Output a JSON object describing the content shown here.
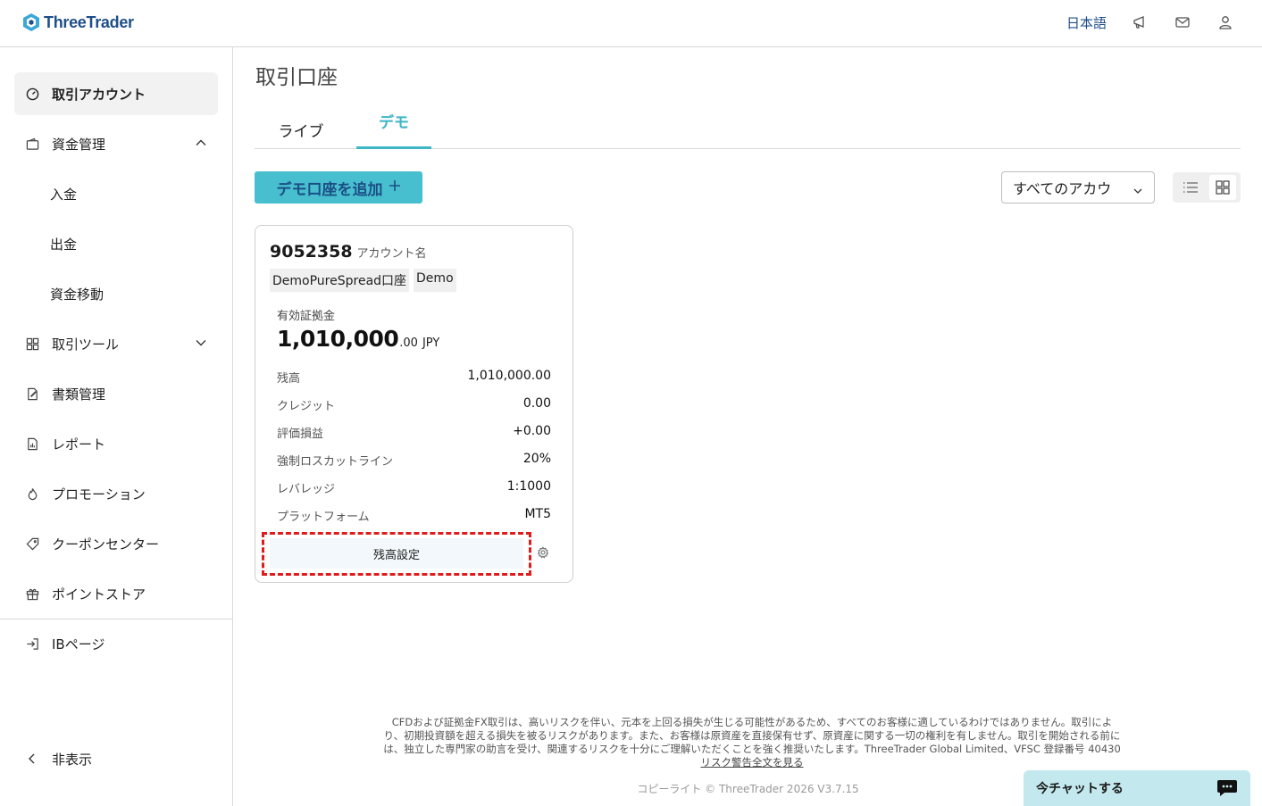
{
  "header": {
    "brand": "ThreeTrader",
    "language": "日本語",
    "icons": [
      "megaphone-icon",
      "mail-icon",
      "user-icon"
    ]
  },
  "sidebar": {
    "items": [
      {
        "label": "取引アカウント",
        "icon": "gauge-icon",
        "active": true
      },
      {
        "label": "資金管理",
        "icon": "wallet-icon",
        "expanded": true
      },
      {
        "label": "入金"
      },
      {
        "label": "出金"
      },
      {
        "label": "資金移動"
      },
      {
        "label": "取引ツール",
        "icon": "tools-icon",
        "expanded": false
      },
      {
        "label": "書類管理",
        "icon": "document-edit-icon"
      },
      {
        "label": "レポート",
        "icon": "report-icon"
      },
      {
        "label": "プロモーション",
        "icon": "flame-icon"
      },
      {
        "label": "クーポンセンター",
        "icon": "tag-icon"
      },
      {
        "label": "ポイントストア",
        "icon": "gift-icon"
      }
    ],
    "ib_page": "IBページ",
    "hide": "非表示"
  },
  "main": {
    "title": "取引口座",
    "tabs": [
      {
        "label": "ライブ",
        "active": false
      },
      {
        "label": "デモ",
        "active": true
      }
    ],
    "add_button": "デモ口座を追加",
    "filter_select": "すべてのアカウ",
    "view_modes": [
      "list-view-icon",
      "grid-view-icon"
    ]
  },
  "card": {
    "account_number": "9052358",
    "account_name_label": "アカウント名",
    "tags": [
      "DemoPureSpread口座",
      "Demo"
    ],
    "equity_label": "有効証拠金",
    "equity_int": "1,010,000",
    "equity_dec": ".00",
    "currency": "JPY",
    "rows": [
      {
        "label": "残高",
        "value": "1,010,000.00"
      },
      {
        "label": "クレジット",
        "value": "0.00"
      },
      {
        "label": "評価損益",
        "value": "+0.00"
      },
      {
        "label": "強制ロスカットライン",
        "value": "20%"
      },
      {
        "label": "レバレッジ",
        "value": "1:1000"
      },
      {
        "label": "プラットフォーム",
        "value": "MT5"
      }
    ],
    "balance_button": "残高設定"
  },
  "footer": {
    "disclaimer_line1": "CFDおよび証拠金FX取引は、高いリスクを伴い、元本を上回る損失が生じる可能性があるため、すべてのお客様に適しているわけではありません。取引によ",
    "disclaimer_line2": "り、初期投資額を超える損失を被るリスクがあります。また、お客様は原資産を直接保有せず、原資産に関する一切の権利を有しません。取引を開始される前に",
    "disclaimer_line3": "は、独立した専門家の助言を受け、関連するリスクを十分にご理解いただくことを強く推奨いたします。ThreeTrader Global Limited、VFSC 登録番号 40430",
    "risk_link": "リスク警告全文を見る",
    "copyright": "コピーライト © ThreeTrader 2026 V3.7.15"
  },
  "chat": {
    "label": "今チャットする"
  },
  "colors": {
    "accent": "#48bfcf",
    "brand_blue": "#1f4f88",
    "highlight_border": "#e01b1b"
  }
}
